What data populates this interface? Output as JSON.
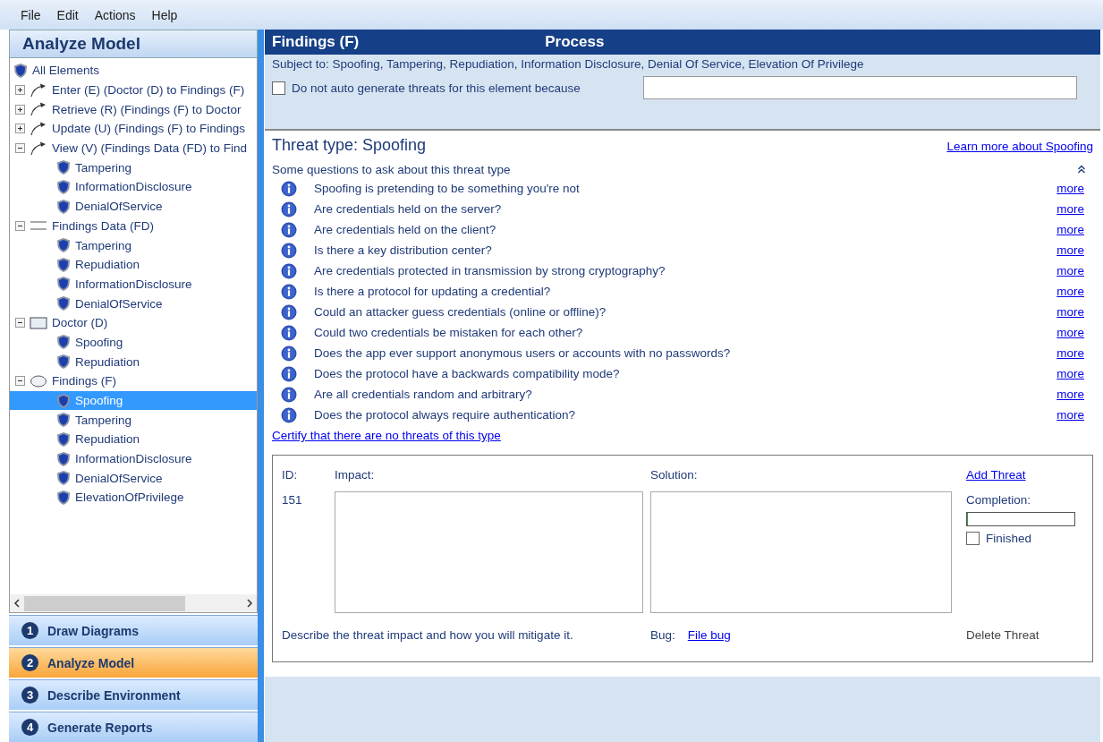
{
  "menu": [
    "File",
    "Edit",
    "Actions",
    "Help"
  ],
  "sidebar": {
    "title": "Analyze Model",
    "tree": {
      "label": "All Elements",
      "kind": "threat",
      "selected": false,
      "children": [
        {
          "label": "Enter (E) (Doctor (D) to Findings (F)",
          "kind": "flow",
          "expanded": false,
          "selected": false
        },
        {
          "label": "Retrieve (R) (Findings (F) to Doctor",
          "kind": "flow",
          "expanded": false,
          "selected": false
        },
        {
          "label": "Update (U) (Findings (F) to Findings",
          "kind": "flow",
          "expanded": false,
          "selected": false
        },
        {
          "label": "View (V) (Findings Data (FD) to Find",
          "kind": "flow",
          "expanded": true,
          "selected": false,
          "children": [
            {
              "label": "Tampering",
              "kind": "threat",
              "selected": false
            },
            {
              "label": "InformationDisclosure",
              "kind": "threat",
              "selected": false
            },
            {
              "label": "DenialOfService",
              "kind": "threat",
              "selected": false
            }
          ]
        },
        {
          "label": "Findings Data (FD)",
          "kind": "store",
          "expanded": true,
          "selected": false,
          "children": [
            {
              "label": "Tampering",
              "kind": "threat",
              "selected": false
            },
            {
              "label": "Repudiation",
              "kind": "threat",
              "selected": false
            },
            {
              "label": "InformationDisclosure",
              "kind": "threat",
              "selected": false
            },
            {
              "label": "DenialOfService",
              "kind": "threat",
              "selected": false
            }
          ]
        },
        {
          "label": "Doctor (D)",
          "kind": "entity",
          "expanded": true,
          "selected": false,
          "children": [
            {
              "label": "Spoofing",
              "kind": "threat",
              "selected": false
            },
            {
              "label": "Repudiation",
              "kind": "threat",
              "selected": false
            }
          ]
        },
        {
          "label": "Findings (F)",
          "kind": "process",
          "expanded": true,
          "selected": false,
          "children": [
            {
              "label": "Spoofing",
              "kind": "threat",
              "selected": true
            },
            {
              "label": "Tampering",
              "kind": "threat",
              "selected": false
            },
            {
              "label": "Repudiation",
              "kind": "threat",
              "selected": false
            },
            {
              "label": "InformationDisclosure",
              "kind": "threat",
              "selected": false
            },
            {
              "label": "DenialOfService",
              "kind": "threat",
              "selected": false
            },
            {
              "label": "ElevationOfPrivilege",
              "kind": "threat",
              "selected": false
            }
          ]
        }
      ]
    },
    "steps": [
      {
        "number": "1",
        "label": "Draw Diagrams",
        "selected": false
      },
      {
        "number": "2",
        "label": "Analyze Model",
        "selected": true
      },
      {
        "number": "3",
        "label": "Describe Environment",
        "selected": false
      },
      {
        "number": "4",
        "label": "Generate Reports",
        "selected": false
      }
    ]
  },
  "element": {
    "name": "Findings (F)",
    "type": "Process",
    "subject": "Subject to: Spoofing, Tampering, Repudiation, Information Disclosure, Denial Of Service, Elevation Of Privilege",
    "auto_generate": {
      "label": "Do not auto generate threats for this element because",
      "checked": false
    }
  },
  "threat": {
    "title": "Threat type: Spoofing",
    "learn_more": "Learn more about Spoofing",
    "questions_heading": "Some questions to ask about this threat type",
    "questions": [
      {
        "text": "Spoofing is pretending to be something you're not",
        "link": "more"
      },
      {
        "text": "Are credentials held on the server?",
        "link": "more"
      },
      {
        "text": "Are credentials held on the client?",
        "link": "more"
      },
      {
        "text": "Is there a key distribution center?",
        "link": "more"
      },
      {
        "text": "Are credentials protected in transmission by strong cryptography?",
        "link": "more"
      },
      {
        "text": "Is there a protocol for updating a credential?",
        "link": "more"
      },
      {
        "text": "Could an attacker guess credentials (online or offline)?",
        "link": "more"
      },
      {
        "text": "Could two credentials be mistaken for each other?",
        "link": "more"
      },
      {
        "text": "Does the app ever support anonymous users or accounts with no passwords?",
        "link": "more"
      },
      {
        "text": "Does the protocol have a backwards compatibility mode?",
        "link": "more"
      },
      {
        "text": "Are all credentials random and arbitrary?",
        "link": "more"
      },
      {
        "text": "Does the protocol always require authentication?",
        "link": "more"
      }
    ],
    "certify": "Certify that there are no threats of this type"
  },
  "entry": {
    "id_label": "ID:",
    "impact_label": "Impact:",
    "solution_label": "Solution:",
    "add": "Add Threat",
    "id": "151",
    "completion_label": "Completion:",
    "completion": {
      "level": 0
    },
    "finished": {
      "label": "Finished",
      "checked": false
    },
    "hint": "Describe the threat impact and how you will mitigate it.",
    "bug_label": "Bug:",
    "file_bug": "File bug",
    "delete": "Delete Threat"
  }
}
